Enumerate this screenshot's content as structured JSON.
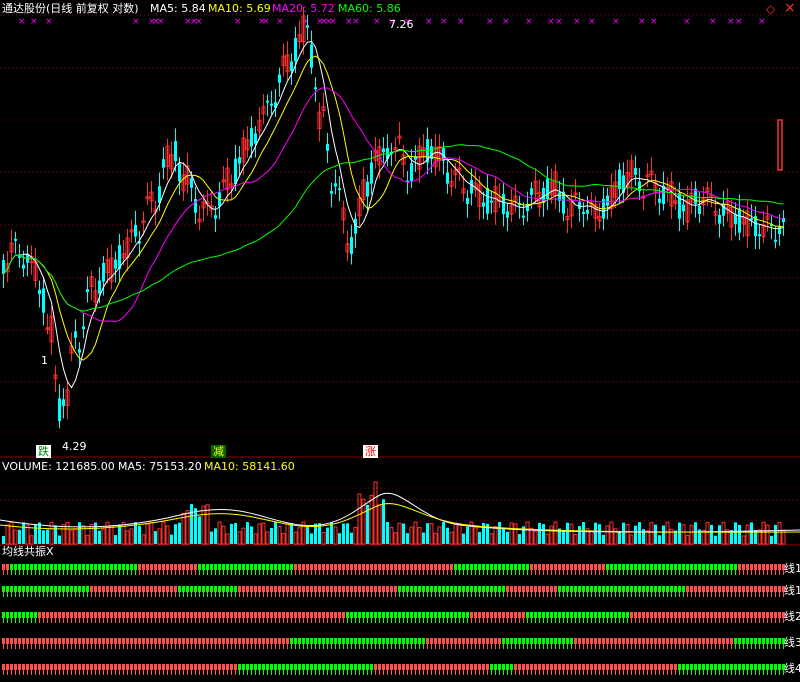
{
  "header": {
    "title": "通达股份(日线 前复权 对数)",
    "ma5": "MA5: 5.84",
    "ma10": "MA10: 5.69",
    "ma20": "MA20: 5.72",
    "ma60": "MA60: 5.86"
  },
  "corner_icons": {
    "diamond": "◇",
    "close": "×"
  },
  "price_annotations": {
    "high": "7.26",
    "low": "4.29",
    "marker_1": "1"
  },
  "signal_tags": {
    "die": "跌",
    "jian": "减",
    "zhang": "涨"
  },
  "volume_header": {
    "volume": "VOLUME: 121685.00",
    "ma5": "MA5: 75153.20",
    "ma10": "MA10: 58141.60"
  },
  "indicator_title": "均线共振X",
  "indicator_rows": [
    "线1",
    "线1",
    "线2",
    "线3",
    "线4"
  ],
  "colors": {
    "up": "#ff3030",
    "down": "#00ffff",
    "ma5": "#ffffff",
    "ma10": "#ffff00",
    "ma20": "#ff00ff",
    "ma60": "#00ff00",
    "grid": "#8b0000"
  }
}
